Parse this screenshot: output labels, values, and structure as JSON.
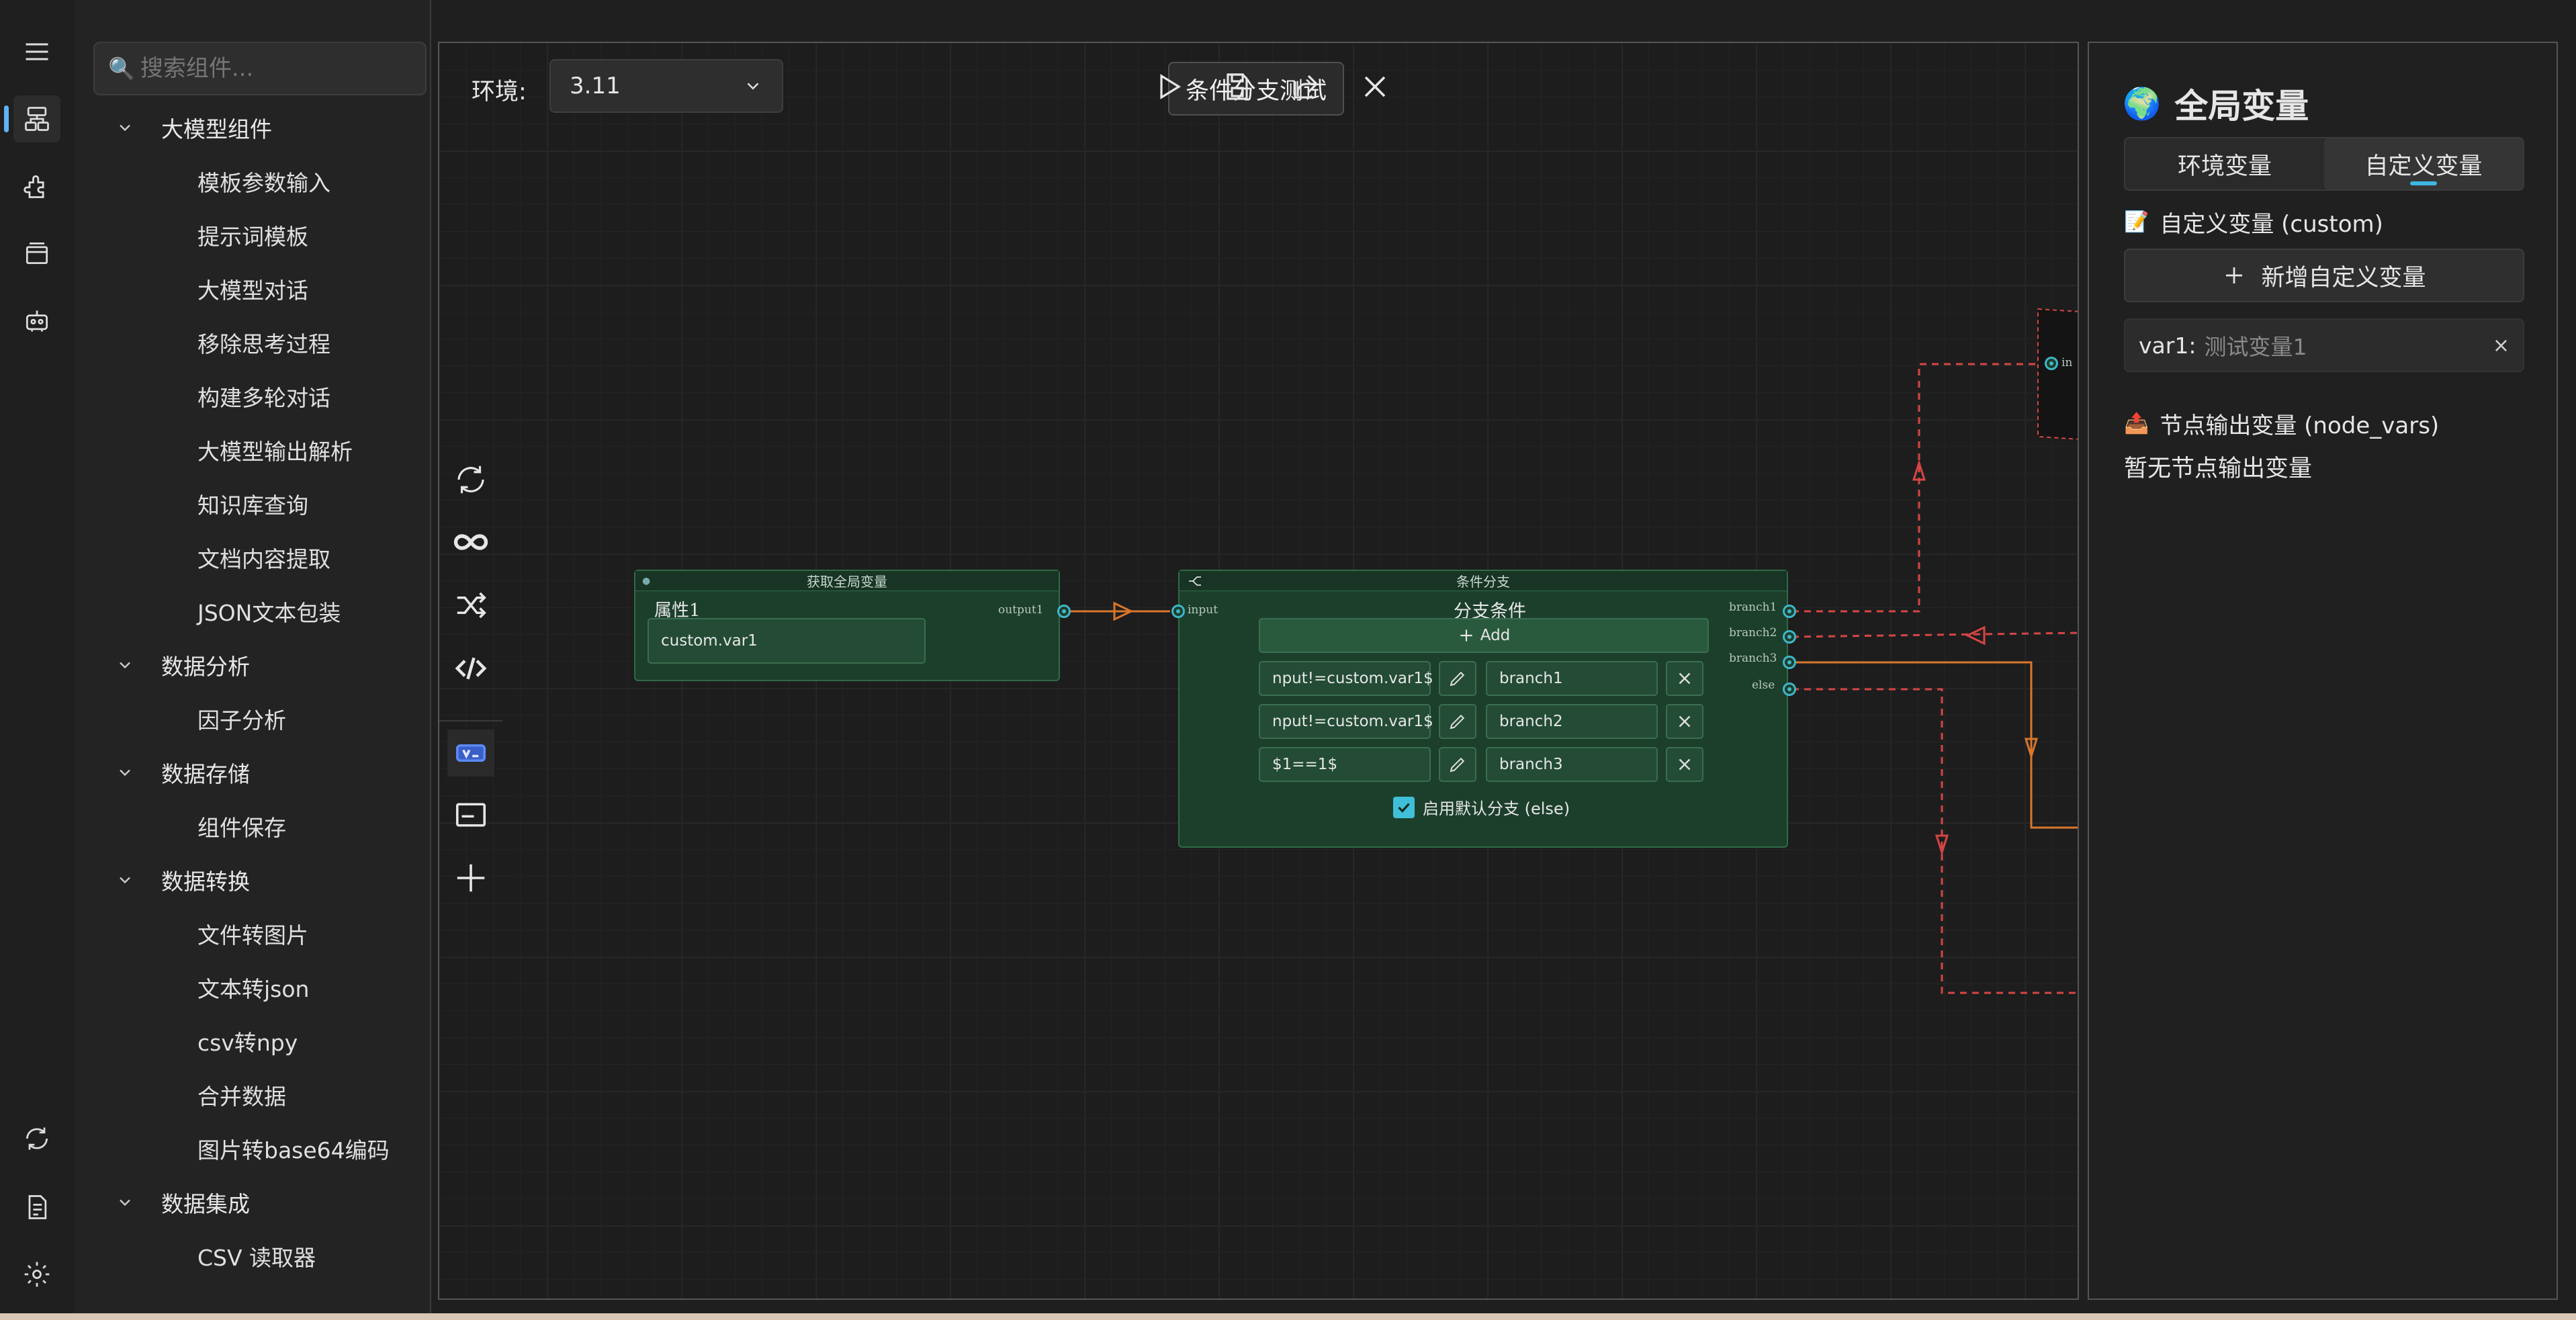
{
  "sidebar": {
    "search": {
      "glyph": "🔍",
      "placeholder": "搜索组件..."
    },
    "groups": [
      {
        "label": "大模型组件",
        "items": [
          "模板参数输入",
          "提示词模板",
          "大模型对话",
          "移除思考过程",
          "构建多轮对话",
          "大模型输出解析",
          "知识库查询",
          "文档内容提取",
          "JSON文本包装"
        ]
      },
      {
        "label": "数据分析",
        "items": [
          "因子分析"
        ]
      },
      {
        "label": "数据存储",
        "items": [
          "组件保存"
        ]
      },
      {
        "label": "数据转换",
        "items": [
          "文件转图片",
          "文本转json",
          "csv转npy",
          "合并数据",
          "图片转base64编码"
        ]
      },
      {
        "label": "数据集成",
        "items": [
          "CSV 读取器"
        ]
      }
    ]
  },
  "canvas": {
    "env_label": "环境:",
    "env_value": "3.11",
    "flow_title": "条件分支测试",
    "node_get_var": {
      "header": "获取全局变量",
      "prop_label": "属性1",
      "prop_value": "custom.var1",
      "output_port": "output1"
    },
    "node_branch": {
      "header": "条件分支",
      "title": "分支条件",
      "input_port": "input",
      "add_label": "Add",
      "conditions": [
        {
          "expr": "nput!=custom.var1$",
          "branch": "branch1"
        },
        {
          "expr": "nput!=custom.var1$",
          "branch": "branch2"
        },
        {
          "expr": "$1==1$",
          "branch": "branch3"
        }
      ],
      "outputs": [
        "branch1",
        "branch2",
        "branch3",
        "else"
      ],
      "default_checkbox": "启用默认分支 (else)",
      "default_checked": true
    },
    "offscreen_port": "in"
  },
  "right_panel": {
    "globe": "🌍",
    "title": "全局变量",
    "tabs": [
      "环境变量",
      "自定义变量"
    ],
    "active_tab": 1,
    "custom_section": {
      "emoji": "📝",
      "label": "自定义变量 (custom)"
    },
    "add_button": "新增自定义变量",
    "variables": [
      {
        "name": "var1:",
        "value": "测试变量1",
        "remove": "×"
      }
    ],
    "node_section": {
      "emoji": "📤",
      "label": "节点输出变量 (node_vars)"
    },
    "empty_text": "暂无节点输出变量"
  },
  "colors": {
    "node_bg": "#1c3f2c",
    "port": "#3fb6c8",
    "link_active": "#d9762b",
    "link_dashed": "#d64545",
    "accent": "#3fb6e0"
  }
}
